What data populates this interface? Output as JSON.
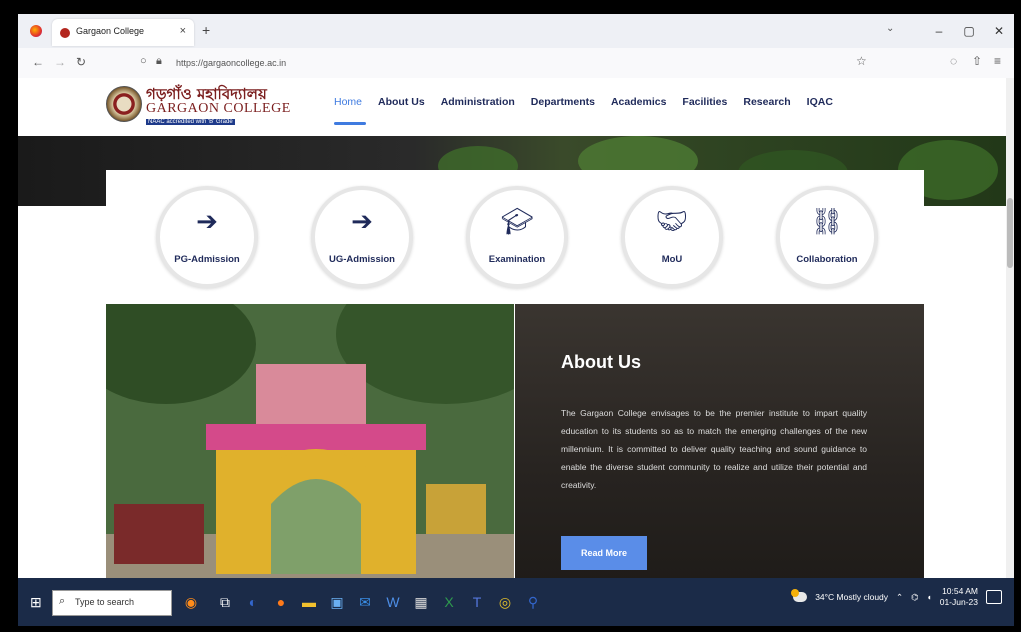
{
  "browser": {
    "tab_title": "Gargaon College",
    "tab_close": "×",
    "new_tab": "+",
    "tab_list": "⌄",
    "url": "https://gargaoncollege.ac.in",
    "window": {
      "minimize": "–",
      "maximize": "▢",
      "close": "✕"
    }
  },
  "site": {
    "logo_bengali": "গড়গাঁও মহাবিদ্যালয়",
    "logo_english": "GARGAON COLLEGE",
    "logo_accreditation": "NAAC accredited with 'B' Grade",
    "menu": [
      "Home",
      "About Us",
      "Administration",
      "Departments",
      "Academics",
      "Facilities",
      "Research",
      "IQAC"
    ],
    "active_menu": "Home"
  },
  "quick_links": [
    {
      "label": "PG-Admission",
      "icon": "sign-in-icon"
    },
    {
      "label": "UG-Admission",
      "icon": "sign-in-icon"
    },
    {
      "label": "Examination",
      "icon": "graduation-cap-icon"
    },
    {
      "label": "MoU",
      "icon": "handshake-icon"
    },
    {
      "label": "Collaboration",
      "icon": "link-icon"
    }
  ],
  "about": {
    "title": "About Us",
    "body": "The Gargaon College envisages to be the premier institute to impart quality education to its students so as to match the emerging challenges of the new millennium. It is committed to deliver quality teaching and sound guidance to enable the diverse student community to realize and utilize their potential and creativity.",
    "button": "Read More"
  },
  "taskbar": {
    "search_placeholder": "Type to search",
    "weather": "34°C  Mostly cloudy",
    "time": "10:54 AM",
    "date": "01-Jun-23"
  },
  "colors": {
    "navy": "#1f2a5a",
    "accent": "#3f7be0",
    "button": "#5a8de8"
  }
}
